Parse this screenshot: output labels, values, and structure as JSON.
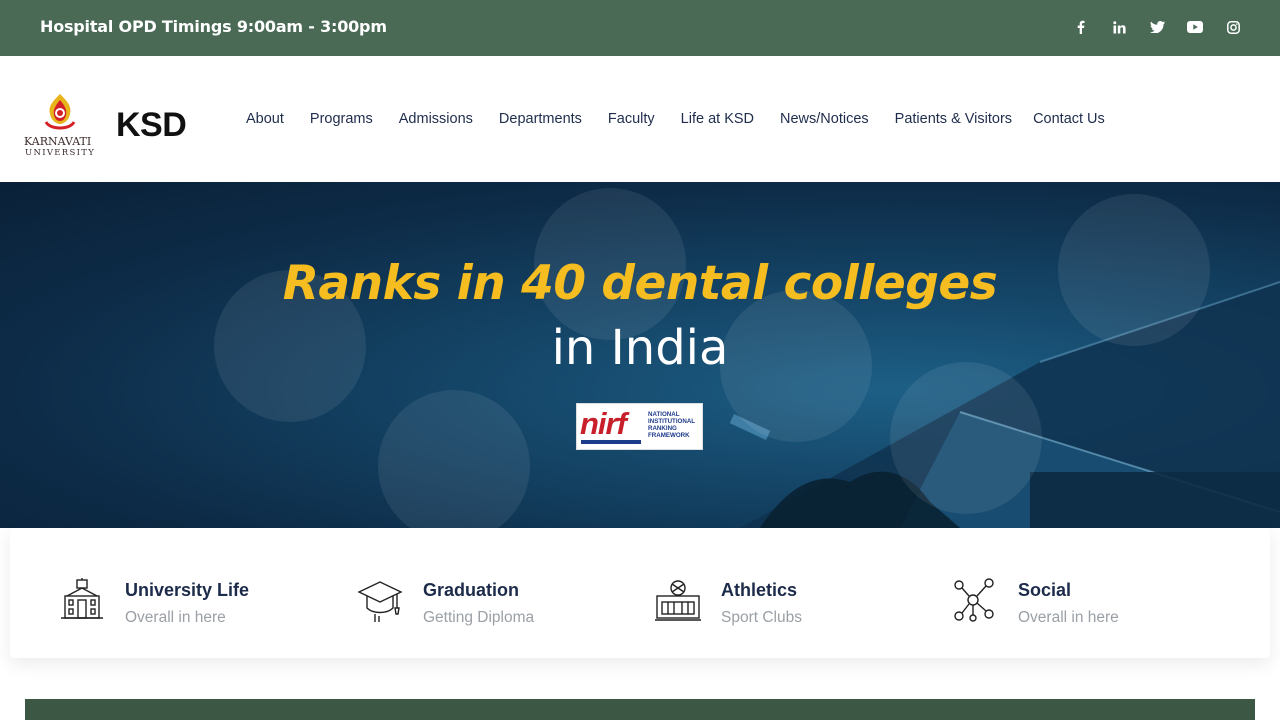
{
  "topbar": {
    "timings": "Hospital OPD Timings 9:00am - 3:00pm",
    "social": [
      "facebook-icon",
      "linkedin-icon",
      "twitter-icon",
      "youtube-icon",
      "instagram-icon"
    ]
  },
  "header": {
    "logo_university_name": "KARNAVATI",
    "logo_university_sub": "UNIVERSITY",
    "logo_ksd": "KSD",
    "nav": [
      "About",
      "Programs",
      "Admissions",
      "Departments",
      "Faculty",
      "Life at KSD",
      "News/Notices",
      "Patients & Visitors",
      "Contact Us"
    ]
  },
  "hero": {
    "headline": "Ranks in 40 dental colleges",
    "subheadline": "in India",
    "badge_logo": "nirf",
    "badge_text": "NATIONAL INSTITUTIONAL RANKING FRAMEWORK"
  },
  "features": [
    {
      "icon": "university-building-icon",
      "title": "University Life",
      "subtitle": "Overall in here"
    },
    {
      "icon": "graduation-cap-icon",
      "title": "Graduation",
      "subtitle": "Getting Diploma"
    },
    {
      "icon": "stadium-icon",
      "title": "Athletics",
      "subtitle": "Sport Clubs"
    },
    {
      "icon": "social-network-icon",
      "title": "Social",
      "subtitle": "Overall in here"
    }
  ],
  "colors": {
    "topbar_bg": "#4a6a56",
    "headline_accent": "#f5bd1f",
    "nav_text": "#1f2d4d",
    "hero_bg": "#0d2b47"
  }
}
